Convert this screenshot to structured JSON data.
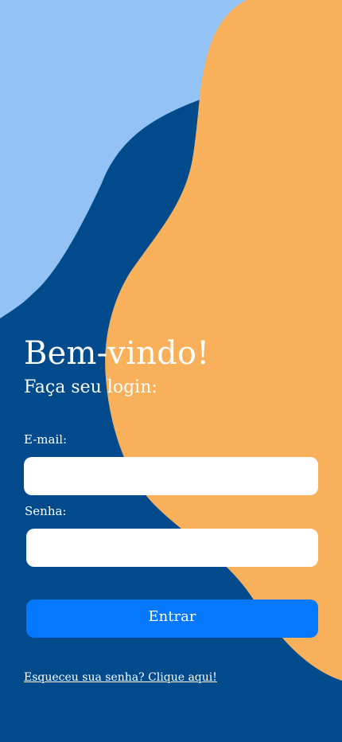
{
  "colors": {
    "background_dark_blue": "#014a8c",
    "background_light_blue": "#93c3f5",
    "background_orange": "#f9b05b",
    "button_blue": "#0478ff",
    "text": "#ffffff",
    "field": "#ffffff"
  },
  "login": {
    "title": "Bem-vindo!",
    "subtitle": "Faça seu login:",
    "email_label": "E-mail:",
    "email_value": "",
    "password_label": "Senha:",
    "password_value": "",
    "submit_label": "Entrar",
    "forgot_link": "Esqueceu sua senha? Clique aqui!"
  }
}
